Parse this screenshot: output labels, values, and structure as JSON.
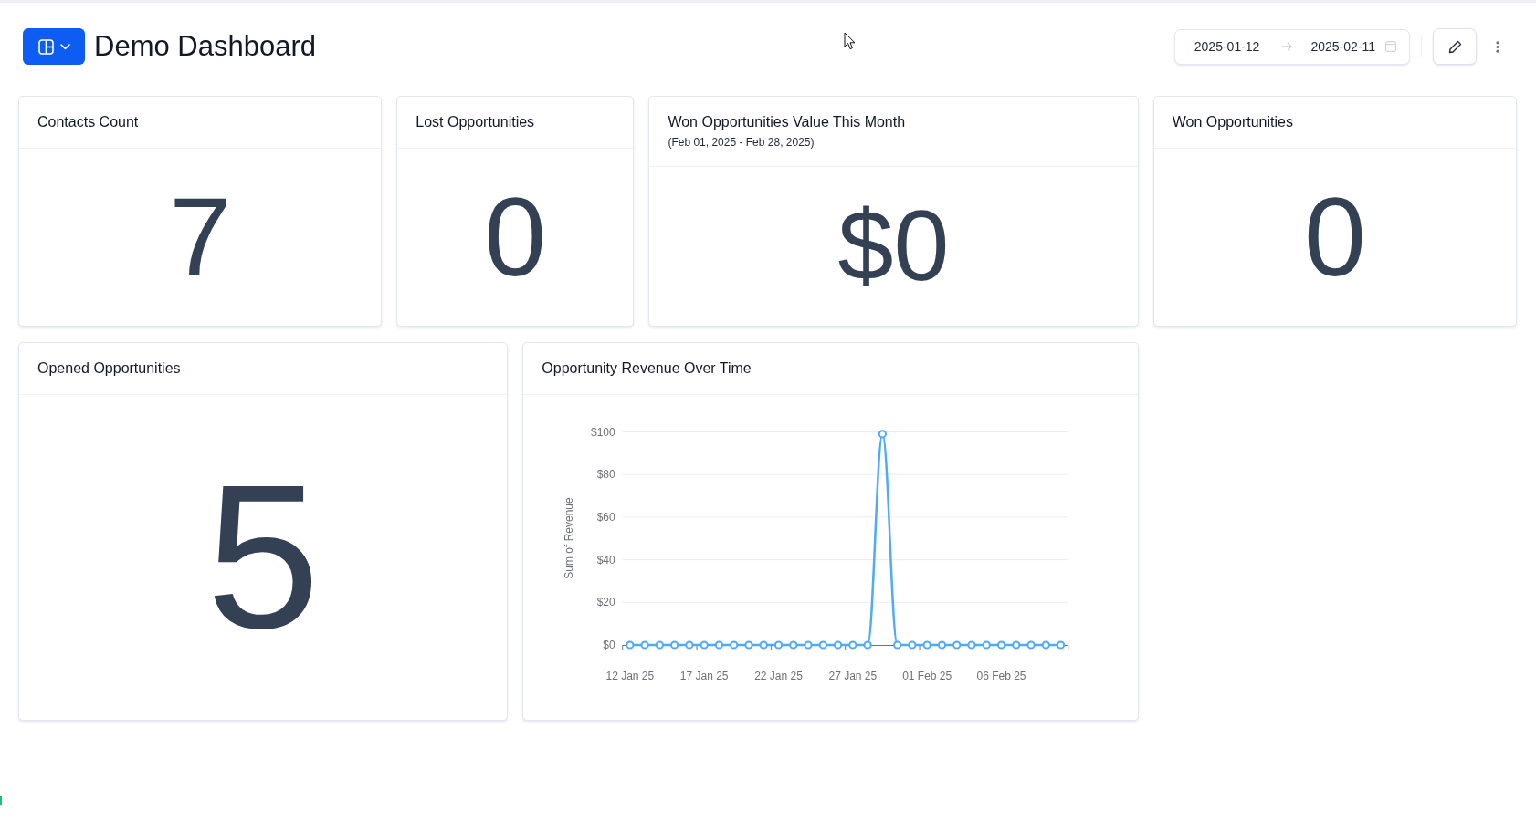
{
  "header": {
    "title": "Demo Dashboard",
    "date_range": {
      "start": "2025-01-12",
      "end": "2025-02-11"
    }
  },
  "cards": [
    {
      "kind": "number",
      "title": "Contacts Count",
      "value": "7"
    },
    {
      "kind": "number",
      "title": "Lost Opportunities",
      "value": "0"
    },
    {
      "kind": "number",
      "title": "Won Opportunities Value This Month",
      "subtitle": "(Feb 01, 2025 - Feb 28, 2025)",
      "value": "$0"
    },
    {
      "kind": "number",
      "title": "Won Opportunities",
      "value": "0"
    },
    {
      "kind": "number",
      "title": "Opened Opportunities",
      "value": "5"
    },
    {
      "kind": "chart",
      "title": "Opportunity Revenue Over Time",
      "chart_data": {
        "type": "line",
        "ylabel": "Sum of Revenue",
        "categories": [
          "12 Jan 25",
          null,
          null,
          null,
          null,
          "17 Jan 25",
          null,
          null,
          null,
          null,
          "22 Jan 25",
          null,
          null,
          null,
          null,
          "27 Jan 25",
          null,
          null,
          null,
          null,
          "01 Feb 25",
          null,
          null,
          null,
          null,
          "06 Feb 25",
          null,
          null,
          null,
          null
        ],
        "ylim": [
          0,
          100
        ],
        "yticks": [
          {
            "value": 0,
            "label": "$0"
          },
          {
            "value": 20,
            "label": "$20"
          },
          {
            "value": 40,
            "label": "$40"
          },
          {
            "value": 60,
            "label": "$60"
          },
          {
            "value": 80,
            "label": "$80"
          },
          {
            "value": 100,
            "label": "$100"
          }
        ],
        "grid": true,
        "series": [
          {
            "color": "#4dabf7",
            "marker": "circle",
            "values": [
              0,
              0,
              0,
              0,
              0,
              0,
              0,
              0,
              0,
              0,
              0,
              0,
              0,
              0,
              0,
              0,
              0,
              99,
              0,
              0,
              0,
              0,
              0,
              0,
              0,
              0,
              0,
              0,
              0,
              0
            ]
          }
        ]
      }
    }
  ]
}
